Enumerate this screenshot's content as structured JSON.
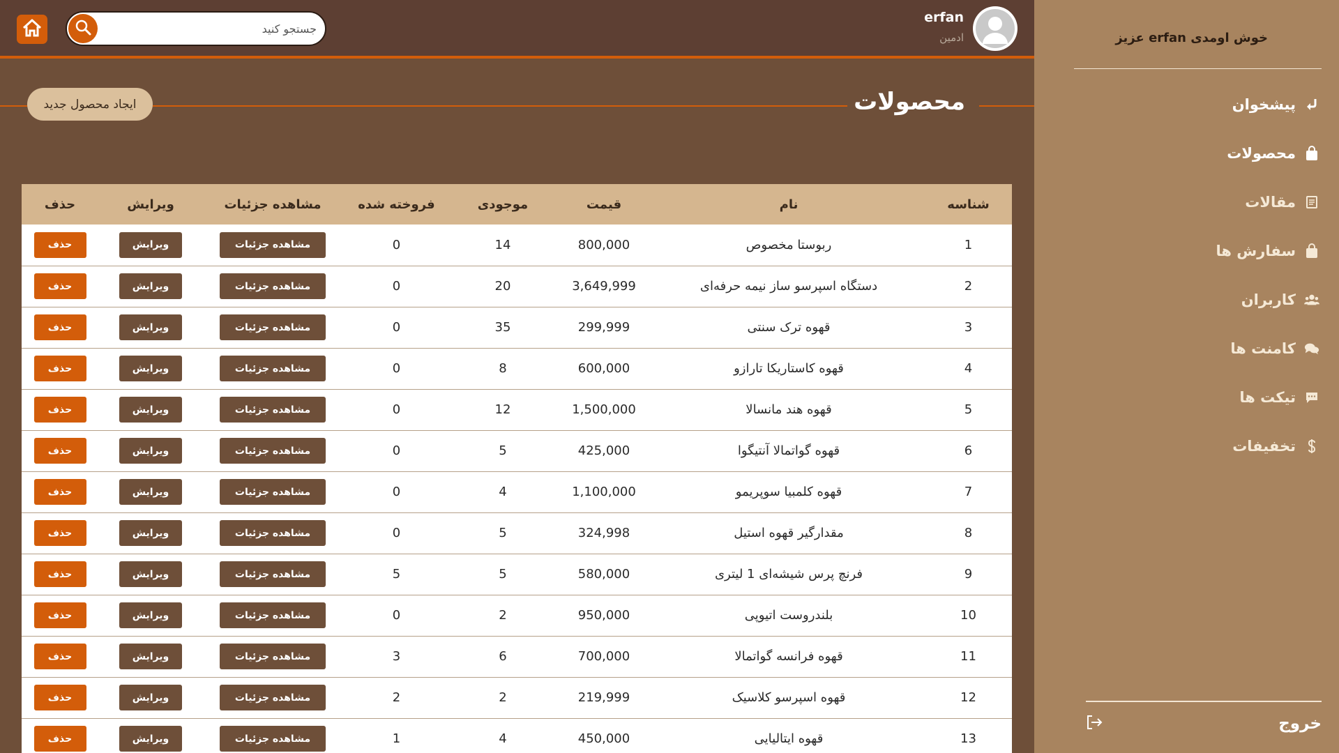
{
  "sidebar": {
    "welcome": "خوش اومدی erfan عزیز",
    "items": [
      {
        "label": "پیشخوان",
        "icon": "arrow-return-icon",
        "active": true
      },
      {
        "label": "محصولات",
        "icon": "bag-icon",
        "active": true
      },
      {
        "label": "مقالات",
        "icon": "document-icon",
        "active": false
      },
      {
        "label": "سفارش ها",
        "icon": "bag-icon",
        "active": false
      },
      {
        "label": "کاربران",
        "icon": "users-icon",
        "active": false
      },
      {
        "label": "کامنت ها",
        "icon": "comments-icon",
        "active": false
      },
      {
        "label": "تیکت ها",
        "icon": "message-icon",
        "active": false
      },
      {
        "label": "تخفیفات",
        "icon": "dollar-icon",
        "active": false
      }
    ],
    "logout_label": "خروج"
  },
  "header": {
    "search_placeholder": "جستجو کنید",
    "user_name": "erfan",
    "user_role": "ادمین"
  },
  "page": {
    "title": "محصولات",
    "create_label": "ایجاد محصول جدید"
  },
  "table": {
    "columns": [
      "شناسه",
      "نام",
      "قیمت",
      "موجودی",
      "فروخته شده",
      "مشاهده جزئیات",
      "ویرایش",
      "حذف"
    ],
    "action_labels": {
      "details": "مشاهده جزئیات",
      "edit": "ویرایش",
      "delete": "حذف"
    },
    "rows": [
      {
        "id": "1",
        "name": "ربوستا مخصوص",
        "price": "800,000",
        "stock": "14",
        "sold": "0"
      },
      {
        "id": "2",
        "name": "دستگاه اسپرسو ساز نیمه حرفه‌ای",
        "price": "3,649,999",
        "stock": "20",
        "sold": "0"
      },
      {
        "id": "3",
        "name": "قهوه ترک سنتی",
        "price": "299,999",
        "stock": "35",
        "sold": "0"
      },
      {
        "id": "4",
        "name": "قهوه کاستاریکا تارازو",
        "price": "600,000",
        "stock": "8",
        "sold": "0"
      },
      {
        "id": "5",
        "name": "قهوه هند مانسالا",
        "price": "1,500,000",
        "stock": "12",
        "sold": "0"
      },
      {
        "id": "6",
        "name": "قهوه گواتمالا آنتیگوا",
        "price": "425,000",
        "stock": "5",
        "sold": "0"
      },
      {
        "id": "7",
        "name": "قهوه کلمبیا سوپریمو",
        "price": "1,100,000",
        "stock": "4",
        "sold": "0"
      },
      {
        "id": "8",
        "name": "مقدارگیر قهوه استیل",
        "price": "324,998",
        "stock": "5",
        "sold": "0"
      },
      {
        "id": "9",
        "name": "فرنچ پرس شیشه‌ای 1 لیتری",
        "price": "580,000",
        "stock": "5",
        "sold": "5"
      },
      {
        "id": "10",
        "name": "بلندروست اتیوپی",
        "price": "950,000",
        "stock": "2",
        "sold": "0"
      },
      {
        "id": "11",
        "name": "قهوه فرانسه گواتمالا",
        "price": "700,000",
        "stock": "6",
        "sold": "3"
      },
      {
        "id": "12",
        "name": "قهوه اسپرسو کلاسیک",
        "price": "219,999",
        "stock": "2",
        "sold": "2"
      },
      {
        "id": "13",
        "name": "قهوه ایتالیایی",
        "price": "450,000",
        "stock": "4",
        "sold": "1"
      }
    ]
  },
  "colors": {
    "sidebar_bg": "#a8845f",
    "main_bg": "#6e4f39",
    "topbar_bg": "#5d3f33",
    "accent": "#d35d0a",
    "table_header_bg": "#d5b68f"
  }
}
